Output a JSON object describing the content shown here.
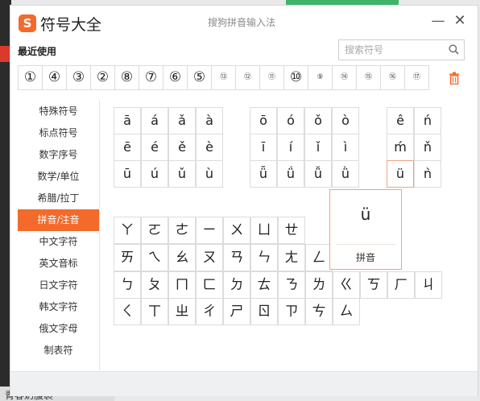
{
  "background": {
    "bottom_text": "青春奶腹裹"
  },
  "window": {
    "logo_letter": "S",
    "title": "符号大全",
    "ime_name": "搜狗拼音输入法",
    "minimize_glyph": "—",
    "close_glyph": "✕"
  },
  "recent": {
    "label": "最近使用",
    "symbols": [
      "①",
      "④",
      "③",
      "②",
      "⑧",
      "⑦",
      "⑥",
      "⑤",
      "⑬",
      "⑫",
      "⑪",
      "⑩",
      "⑨",
      "⑭",
      "⑮",
      "⑯",
      "⑰"
    ]
  },
  "search": {
    "placeholder": "搜索符号"
  },
  "sidebar": {
    "items": [
      {
        "label": "特殊符号"
      },
      {
        "label": "标点符号"
      },
      {
        "label": "数字序号"
      },
      {
        "label": "数学/单位"
      },
      {
        "label": "希腊/拉丁"
      },
      {
        "label": "拼音/注音"
      },
      {
        "label": "中文字符"
      },
      {
        "label": "英文音标"
      },
      {
        "label": "日文字符"
      },
      {
        "label": "韩文字符"
      },
      {
        "label": "俄文字母"
      },
      {
        "label": "制表符"
      }
    ],
    "active_index": 5
  },
  "pinyin": {
    "group1": [
      "ā",
      "á",
      "ǎ",
      "à",
      "ē",
      "é",
      "ě",
      "è",
      "ū",
      "ú",
      "ǔ",
      "ù"
    ],
    "group2": [
      "ō",
      "ó",
      "ǒ",
      "ò",
      "ī",
      "í",
      "ǐ",
      "ì",
      "ǖ",
      "ǘ",
      "ǚ",
      "ǜ"
    ],
    "group3": [
      "ê",
      "ń",
      "ḿ",
      "ň",
      "ü",
      "ǹ"
    ],
    "highlight": "ü"
  },
  "zhuyin": {
    "rows": [
      [
        "ㄚ",
        "ㄛ",
        "ㄜ",
        "ㄧ",
        "ㄨ",
        "ㄩ",
        "ㄝ"
      ],
      [
        "ㄞ",
        "ㄟ",
        "ㄠ",
        "ㄡ",
        "ㄢ",
        "ㄣ",
        "ㄤ",
        "ㄥ"
      ],
      [
        "ㄅ",
        "ㄆ",
        "ㄇ",
        "ㄈ",
        "ㄉ",
        "ㄊ",
        "ㄋ",
        "ㄌ",
        "ㄍ",
        "ㄎ",
        "ㄏ",
        "ㄐ"
      ],
      [
        "ㄑ",
        "ㄒ",
        "ㄓ",
        "ㄔ",
        "ㄕ",
        "ㄖ",
        "ㄗ",
        "ㄘ",
        "ㄙ"
      ]
    ]
  },
  "tooltip": {
    "char": "ü",
    "label": "拼音"
  },
  "colors": {
    "accent": "#f36a2b",
    "border": "#dcdcdc"
  }
}
